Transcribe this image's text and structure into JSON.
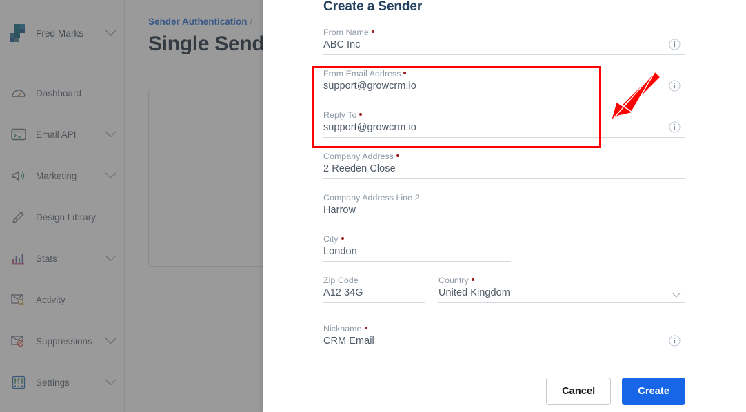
{
  "sidebar": {
    "account": {
      "name": "Fred Marks",
      "caret": "chevron-down-icon"
    },
    "items": [
      {
        "label": "Dashboard",
        "icon": "gauge-icon",
        "caret": false
      },
      {
        "label": "Email API",
        "icon": "terminal-icon",
        "caret": true
      },
      {
        "label": "Marketing",
        "icon": "megaphone-icon",
        "caret": true
      },
      {
        "label": "Design Library",
        "icon": "pencil-ruler-icon",
        "caret": false
      },
      {
        "label": "Stats",
        "icon": "bar-chart-icon",
        "caret": true
      },
      {
        "label": "Activity",
        "icon": "envelope-search-icon",
        "caret": false
      },
      {
        "label": "Suppressions",
        "icon": "envelope-block-icon",
        "caret": true
      },
      {
        "label": "Settings",
        "icon": "sliders-icon",
        "caret": true
      }
    ]
  },
  "page": {
    "breadcrumb_parent": "Sender Authentication",
    "breadcrumb_separator": "/",
    "title": "Single Sender"
  },
  "modal": {
    "title": "Create a Sender",
    "fields": {
      "from_name": {
        "label": "From Name",
        "value": "ABC Inc",
        "required": true,
        "info": "info-icon"
      },
      "from_email": {
        "label": "From Email Address",
        "value": "support@growcrm.io",
        "required": true,
        "info": "info-icon"
      },
      "reply_to": {
        "label": "Reply To",
        "value": "support@growcrm.io",
        "required": true,
        "info": "info-icon"
      },
      "company_address": {
        "label": "Company Address",
        "value": "2 Reeden Close",
        "required": true
      },
      "address_line2": {
        "label": "Company Address Line 2",
        "value": "Harrow",
        "required": false
      },
      "city": {
        "label": "City",
        "value": "London",
        "required": true
      },
      "zip": {
        "label": "Zip Code",
        "value": "A12 34G",
        "required": false
      },
      "country": {
        "label": "Country",
        "value": "United Kingdom",
        "required": true,
        "caret": "chevron-down-icon"
      },
      "nickname": {
        "label": "Nickname",
        "value": "CRM Email",
        "required": true,
        "info": "info-icon"
      }
    },
    "buttons": {
      "cancel": "Cancel",
      "create": "Create"
    }
  },
  "annotations": {
    "highlight_box": {
      "color": "#ff0000"
    },
    "arrow": {
      "color": "#ff0000",
      "points_to": "from-email-and-reply-to-fields"
    }
  },
  "colors": {
    "accent_blue": "#1766e8",
    "link_blue": "#2a6fd6",
    "title_navy": "#24425f",
    "required_dot": "#9e1b1b",
    "annotation_red": "#ff0000"
  }
}
